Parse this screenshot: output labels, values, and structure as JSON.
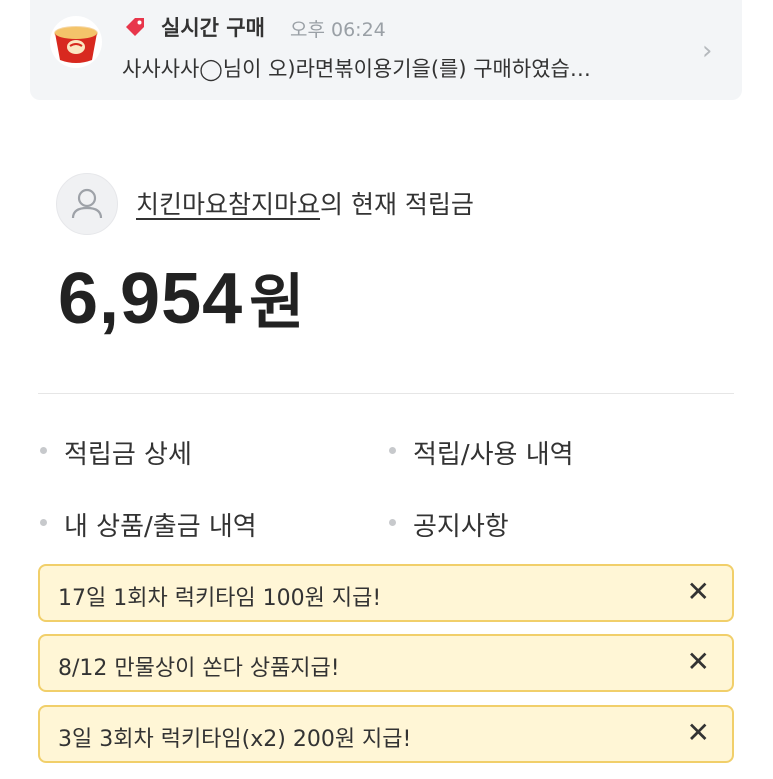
{
  "notification": {
    "title": "실시간 구매",
    "time": "오후 06:24",
    "message": "사사사사◯님이 오)라면볶이용기을(를) 구매하였습…"
  },
  "account": {
    "username": "치킨마요참지마요",
    "points_label_suffix": "의 현재 적립금",
    "points_amount": "6,954",
    "points_unit": "원"
  },
  "menu": {
    "points_detail": "적립금 상세",
    "earn_use_history": "적립/사용 내역",
    "my_products_withdraw": "내 상품/출금 내역",
    "notice": "공지사항"
  },
  "banners": [
    {
      "text": "17일 1회차 럭키타임 100원 지급!"
    },
    {
      "text": "8/12 만물상이 쏜다 상품지급!"
    },
    {
      "text": "3일 3회차 럭키타임(x2) 200원 지급!"
    }
  ],
  "colors": {
    "banner_bg": "#fff6d6",
    "banner_border": "#f1cf6a",
    "tag_red": "#e8364b"
  }
}
